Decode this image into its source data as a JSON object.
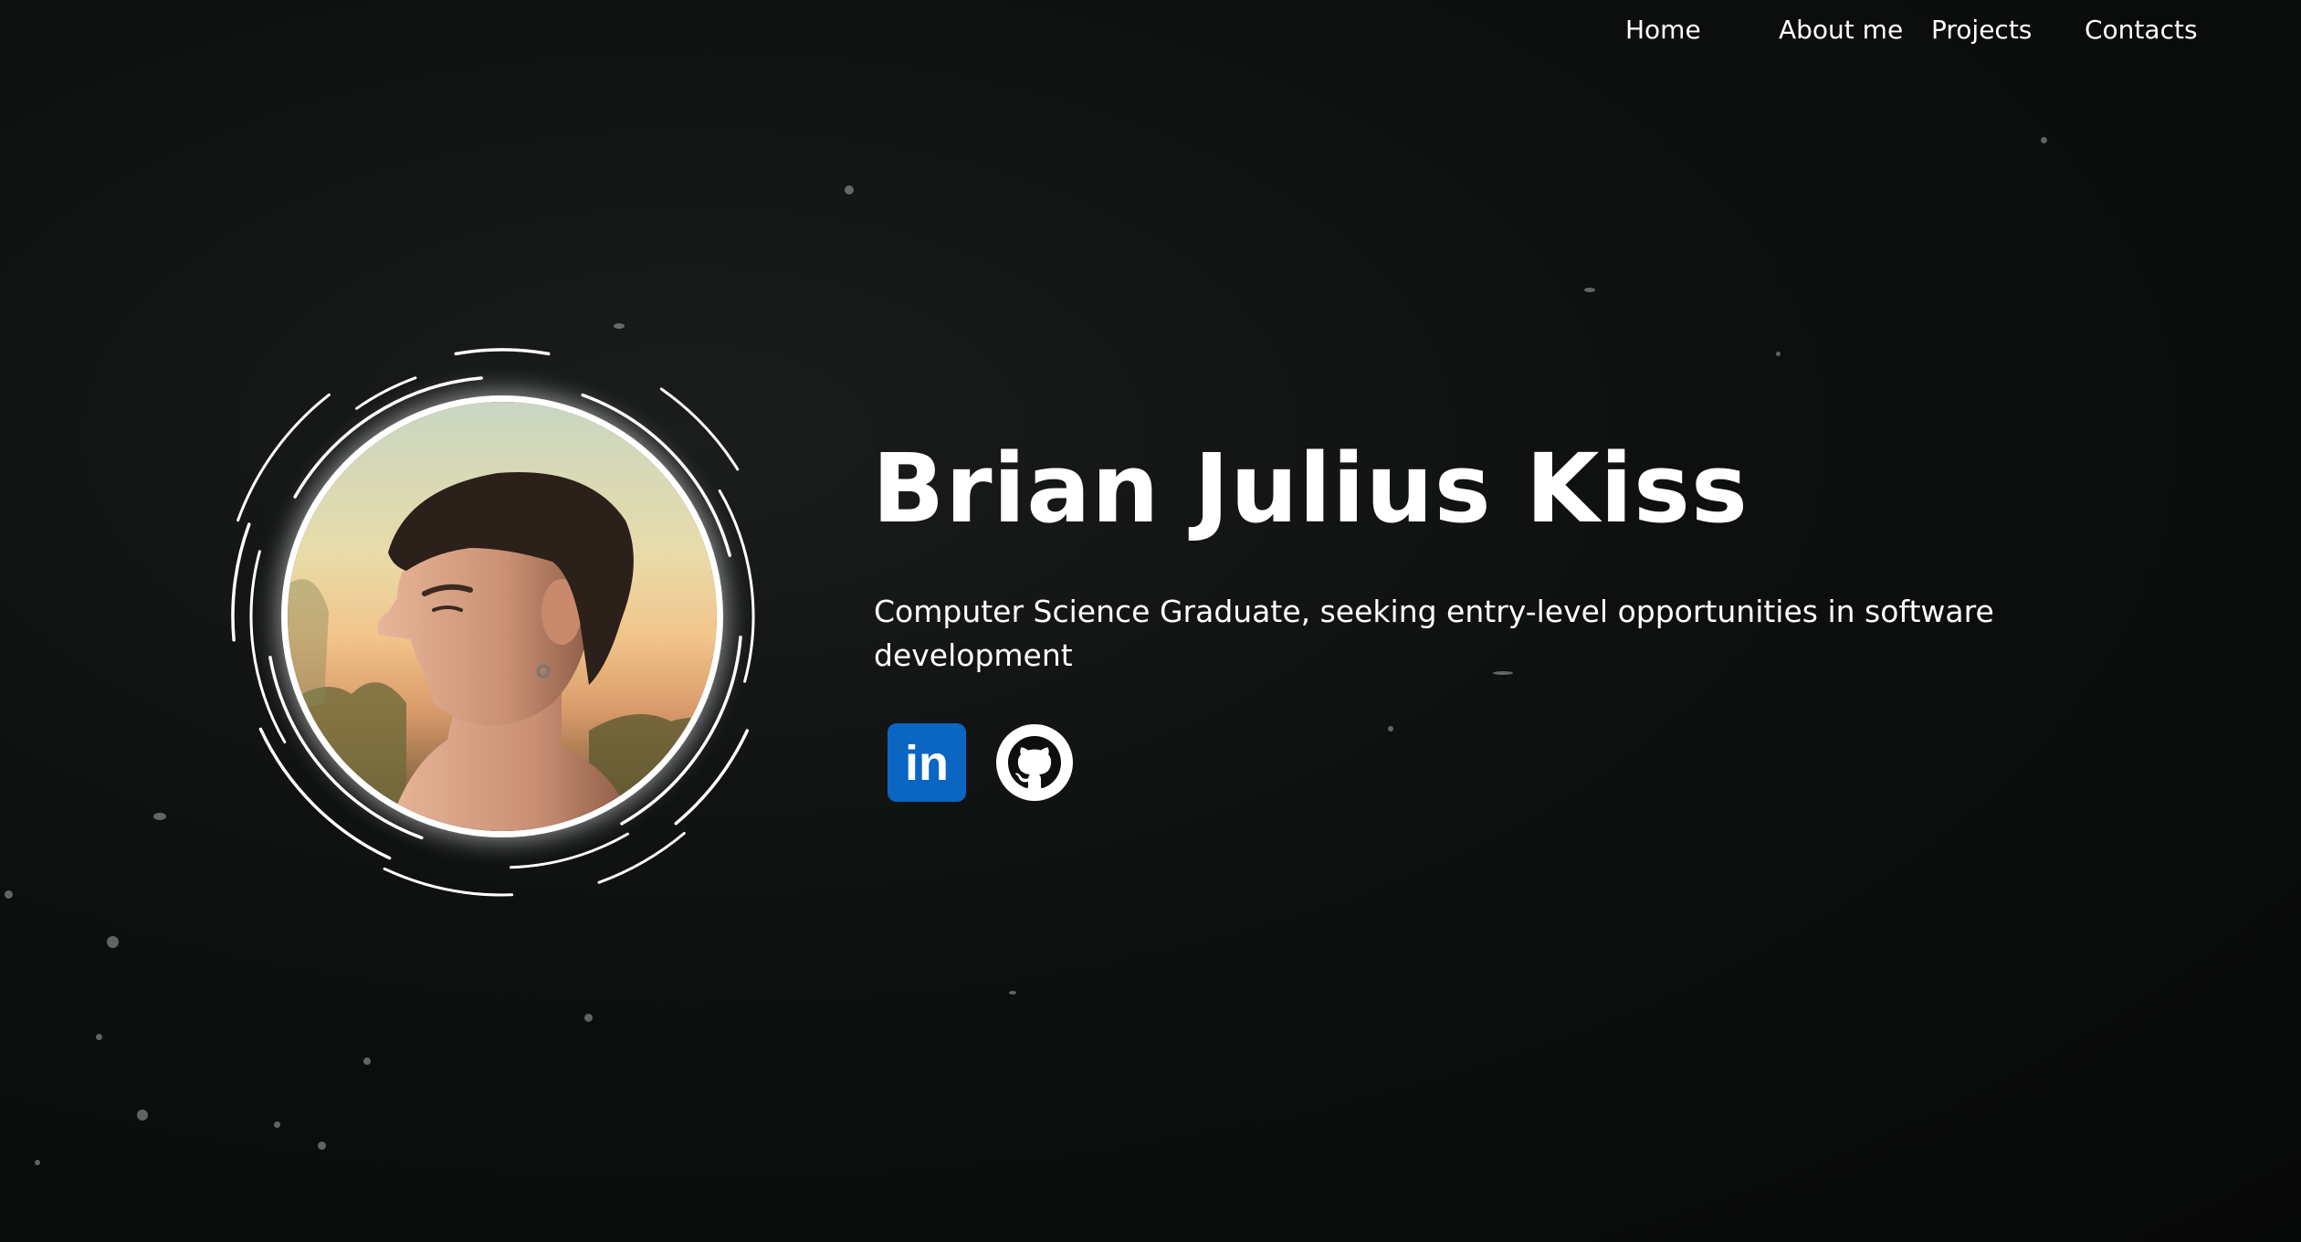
{
  "nav": {
    "items": [
      {
        "label": "Home"
      },
      {
        "label": "About me"
      },
      {
        "label": "Projects"
      },
      {
        "label": "Contacts"
      }
    ]
  },
  "hero": {
    "name": "Brian Julius Kiss",
    "tagline": "Computer Science Graduate, seeking entry-level opportunities in software development"
  },
  "socials": [
    {
      "icon": "linkedin-icon",
      "label": "in",
      "color": "#0a66c2"
    },
    {
      "icon": "github-icon",
      "color": "#ffffff"
    }
  ],
  "colors": {
    "background": "#0d0f0f",
    "text": "#ffffff",
    "linkedin": "#0a66c2"
  }
}
